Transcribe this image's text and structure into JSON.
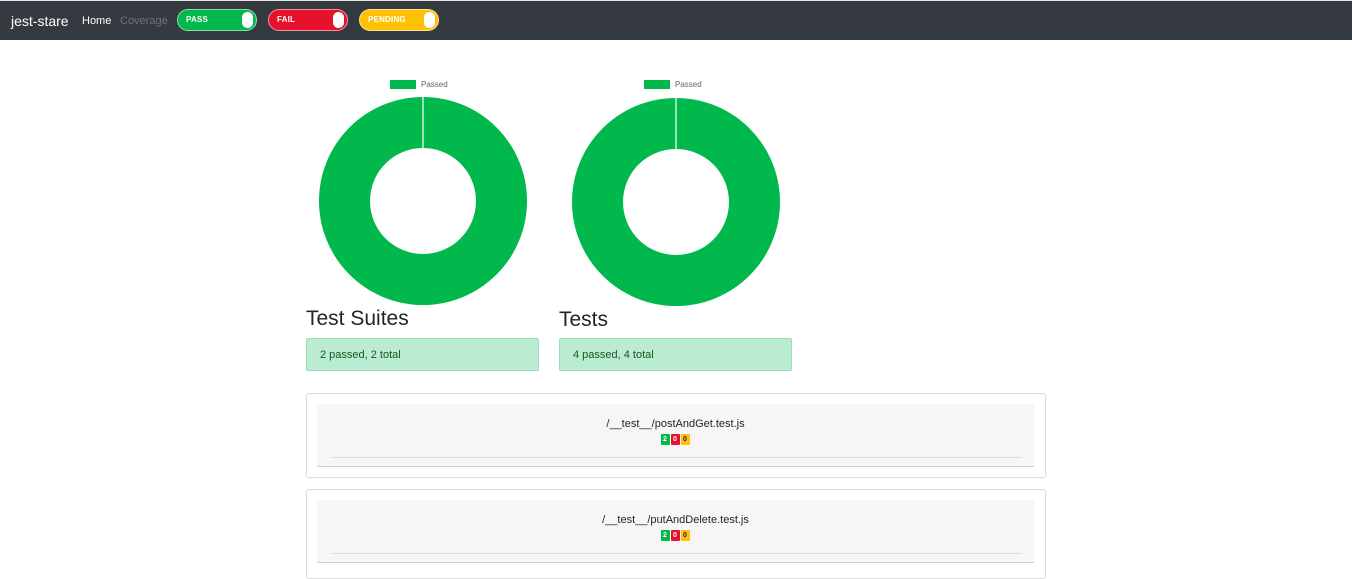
{
  "navbar": {
    "brand": "jest-stare",
    "home": "Home",
    "coverage": "Coverage",
    "toggles": [
      {
        "label": "PASS",
        "color": "#00b84c"
      },
      {
        "label": "FAIL",
        "color": "#e8112d"
      },
      {
        "label": "PENDING",
        "color": "#ffc107"
      }
    ]
  },
  "suites_chart": {
    "legend": "Passed",
    "title": "Test Suites",
    "summary": "2 passed, 2 total"
  },
  "tests_chart": {
    "legend": "Passed",
    "title": "Tests",
    "summary": "4 passed, 4 total"
  },
  "chart_data": [
    {
      "type": "pie",
      "title": "Test Suites",
      "categories": [
        "Passed"
      ],
      "values": [
        2
      ],
      "legend": "top"
    },
    {
      "type": "pie",
      "title": "Tests",
      "categories": [
        "Passed"
      ],
      "values": [
        4
      ],
      "legend": "top"
    }
  ],
  "results": [
    {
      "file": "/__test__/postAndGet.test.js",
      "passed": "2",
      "failed": "0",
      "pending": "0"
    },
    {
      "file": "/__test__/putAndDelete.test.js",
      "passed": "2",
      "failed": "0",
      "pending": "0"
    }
  ],
  "colors": {
    "pass": "#00b84c",
    "fail": "#e8112d",
    "pending": "#ffc107",
    "navbar": "#343a40"
  }
}
